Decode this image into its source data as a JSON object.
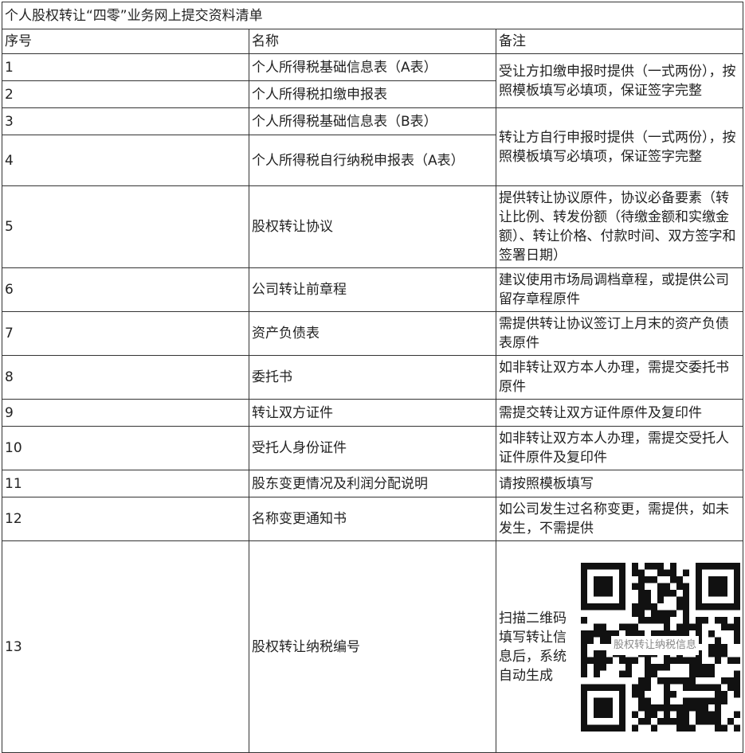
{
  "table": {
    "title": "个人股权转让“四零”业务网上提交资料清单",
    "headers": [
      "序号",
      "名称",
      "备注"
    ],
    "rows": [
      {
        "no": "1",
        "name": "个人所得税基础信息表（A表）"
      },
      {
        "no": "2",
        "name": "个人所得税扣缴申报表"
      },
      {
        "no": "3",
        "name": "个人所得税基础信息表（B表）"
      },
      {
        "no": "4",
        "name": "个人所得税自行纳税申报表（A表）"
      },
      {
        "no": "5",
        "name": "股权转让协议",
        "note": "提供转让协议原件，协议必备要素（转让比例、转发份额（待缴金额和实缴金额）、转让价格、付款时间、双方签字和签署日期）"
      },
      {
        "no": "6",
        "name": "公司转让前章程",
        "note": "建议使用市场局调档章程，或提供公司留存章程原件"
      },
      {
        "no": "7",
        "name": "资产负债表",
        "note": "需提供转让协议签订上月末的资产负债表原件"
      },
      {
        "no": "8",
        "name": "委托书",
        "note": "如非转让双方本人办理，需提交委托书原件"
      },
      {
        "no": "9",
        "name": "转让双方证件",
        "note": "需提交转让双方证件原件及复印件"
      },
      {
        "no": "10",
        "name": "受托人身份证件",
        "note": "如非转让双方本人办理，需提交受托人证件原件及复印件"
      },
      {
        "no": "11",
        "name": "股东变更情况及利润分配说明",
        "note": "请按照模板填写"
      },
      {
        "no": "12",
        "name": "名称变更通知书",
        "note": "如公司发生过名称变更，需提供，如未发生，不需提供"
      },
      {
        "no": "13",
        "name": "股权转让纳税编号",
        "note": "扫描二维码填写转让信息后，系统自动生成"
      }
    ],
    "merged_notes": {
      "rows_1_2": "受让方扣缴申报时提供（一式两份），按照模板填写必填项，保证签字完整",
      "rows_3_4": "转让方自行申报时提供（一式两份），按照模板填写必填项，保证签字完整"
    },
    "qr_label": "股权转让纳税信息"
  }
}
